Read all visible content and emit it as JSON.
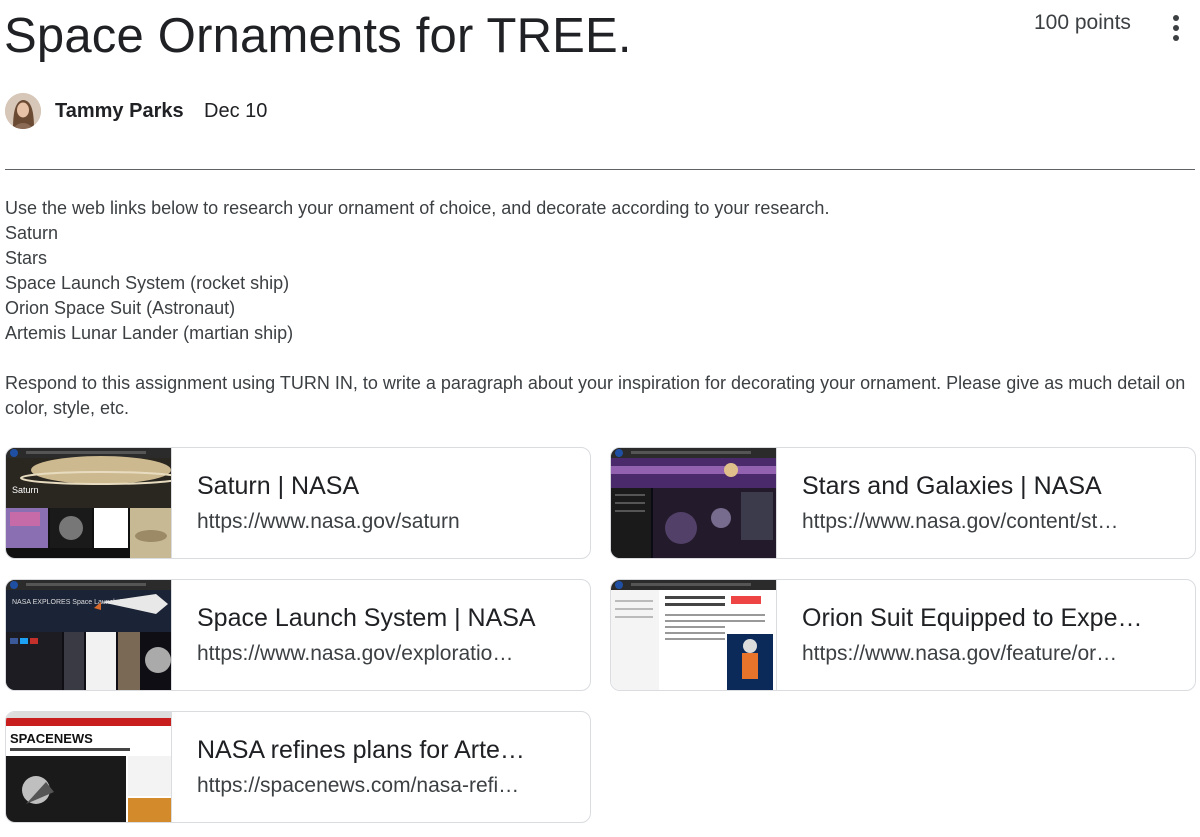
{
  "assignment": {
    "title": "Space Ornaments for TREE.",
    "points": "100 points",
    "author": "Tammy Parks",
    "date": "Dec 10"
  },
  "description": {
    "intro": "Use the web links below to research your ornament of choice, and decorate according to your research.",
    "items": [
      "Saturn",
      "Stars",
      "Space Launch System (rocket ship)",
      "Orion Space Suit (Astronaut)",
      "Artemis Lunar Lander (martian ship)"
    ],
    "instructions": "Respond to this assignment using TURN IN, to write a paragraph about your inspiration for decorating your ornament. Please give as much detail on color, style, etc."
  },
  "links": [
    {
      "title": "Saturn | NASA",
      "url": "https://www.nasa.gov/saturn",
      "thumb_label": "Saturn"
    },
    {
      "title": "Stars and Galaxies | NASA",
      "url": "https://www.nasa.gov/content/st…",
      "thumb_label": ""
    },
    {
      "title": "Space Launch System | NASA",
      "url": "https://www.nasa.gov/exploratio…",
      "thumb_label": "NASA EXPLORES Space Launch System"
    },
    {
      "title": "Orion Suit Equipped to Expe…",
      "url": "https://www.nasa.gov/feature/or…",
      "thumb_label": ""
    },
    {
      "title": "NASA refines plans for Arte…",
      "url": "https://spacenews.com/nasa-refi…",
      "thumb_label": "SPACENEWS"
    }
  ],
  "icons": {
    "more": "more-vert-icon",
    "avatar": "avatar"
  }
}
